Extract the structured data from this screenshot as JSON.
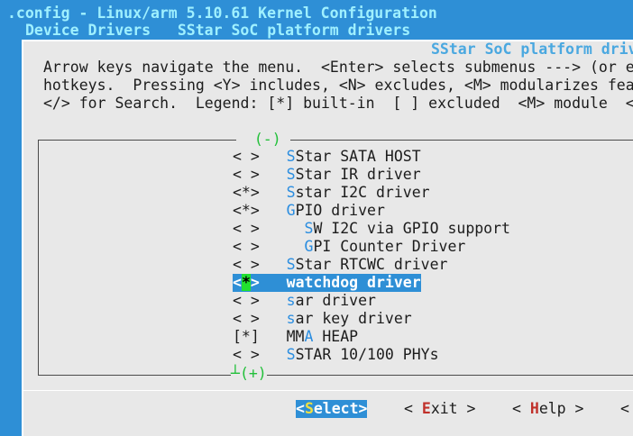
{
  "header": {
    "title": ".config - Linux/arm 5.10.61 Kernel Configuration",
    "breadcrumb": "Device Drivers   SStar SoC platform drivers"
  },
  "dialog": {
    "title": "SStar SoC platform driv",
    "help_lines": [
      "Arrow keys navigate the menu.  <Enter> selects submenus ---> (or e",
      "hotkeys.  Pressing <Y> includes, <N> excludes, <M> modularizes fea",
      "</> for Search.  Legend: [*] built-in  [ ] excluded  <M> module  <"
    ],
    "scroll_top": "(-)",
    "scroll_bottom": "(+)"
  },
  "menu": {
    "items": [
      {
        "mark": "< >",
        "hot": "S",
        "rest": "Star SATA HOST",
        "indent": ""
      },
      {
        "mark": "< >",
        "hot": "S",
        "rest": "Star IR driver",
        "indent": ""
      },
      {
        "mark": "<*>",
        "hot": "S",
        "rest": "star I2C driver",
        "indent": ""
      },
      {
        "mark": "<*>",
        "hot": "G",
        "rest": "PIO driver",
        "indent": ""
      },
      {
        "mark": "< >",
        "hot": "S",
        "rest": "W I2C via GPIO support",
        "indent": "  "
      },
      {
        "mark": "< >",
        "hot": "G",
        "rest": "PI Counter Driver",
        "indent": "  "
      },
      {
        "mark": "< >",
        "hot": "S",
        "rest": "Star RTCWC driver",
        "indent": ""
      },
      {
        "mark": "<*>",
        "hot": "w",
        "rest": "atchdog driver",
        "indent": "",
        "selected": true
      },
      {
        "mark": "< >",
        "hot": "s",
        "rest": "ar driver",
        "indent": ""
      },
      {
        "mark": "< >",
        "hot": "s",
        "rest": "ar key driver",
        "indent": ""
      },
      {
        "mark": "[*]",
        "pre": "MM",
        "hot": "A",
        "rest": " HEAP",
        "indent": ""
      },
      {
        "mark": "< >",
        "hot": "S",
        "rest": "STAR 10/100 PHYs",
        "indent": ""
      }
    ]
  },
  "buttons": {
    "select": {
      "open": "<",
      "key": "S",
      "rest": "elect",
      "close": ">"
    },
    "exit": {
      "open": "< ",
      "key": "E",
      "rest": "xit",
      "close": " >"
    },
    "help": {
      "open": "< ",
      "key": "H",
      "rest": "elp",
      "close": " >"
    },
    "save": {
      "open": "< "
    }
  },
  "colors": {
    "background": "#2e8fd6",
    "dialog": "#e8e8e8",
    "title": "#9ff0ff",
    "hotkey": "#2a8de0",
    "cursor": "#22e030",
    "button_key": "#c0302a"
  }
}
